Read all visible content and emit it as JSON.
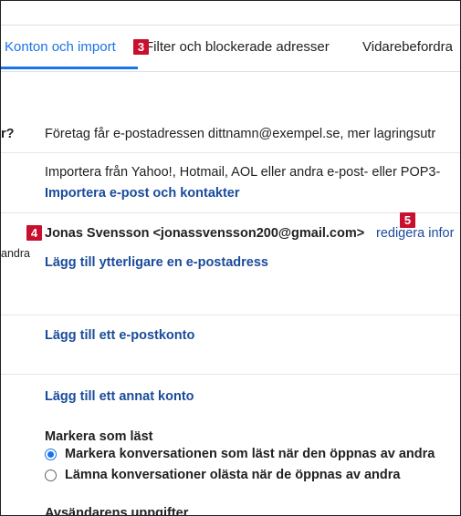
{
  "tabs": [
    {
      "label": "Konton och import",
      "active": true
    },
    {
      "label": "Filter och blockerade adresser",
      "active": false
    },
    {
      "label": "Vidarebefordra",
      "active": false
    }
  ],
  "badges": {
    "b3": "3",
    "b4": "4",
    "b5": "5"
  },
  "rows": {
    "account_label_fragment": "r?",
    "account_text": "Företag får e-postadressen dittnamn@exempel.se, mer lagringsutr",
    "import_text": "Importera från Yahoo!, Hotmail, AOL eller andra e-post- eller POP3-",
    "import_link": "Importera e-post och kontakter",
    "send_as_label_fragment": "andra",
    "sender_identity": "Jonas Svensson <jonassvensson200@gmail.com>",
    "edit_info_link": "redigera infor",
    "add_email_link": "Lägg till ytterligare en e-postadress",
    "add_mail_account_link": "Lägg till ett e-postkonto",
    "add_other_account_link": "Lägg till ett annat konto",
    "mark_read_heading": "Markera som läst",
    "mark_read_option_1": "Markera konversationen som läst när den öppnas av andra",
    "mark_read_option_2": "Lämna konversationer olästa när de öppnas av andra",
    "sender_info_heading": "Avsändarens uppgifter"
  },
  "colors": {
    "accent": "#1a73e8",
    "link": "#1a4b9b",
    "badge": "#c8102e"
  }
}
